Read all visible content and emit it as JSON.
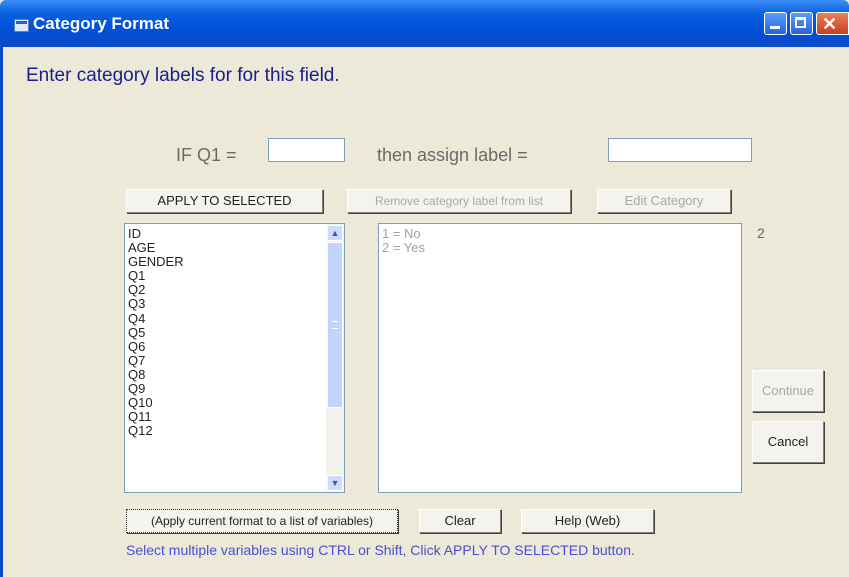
{
  "window": {
    "title": "Category Format"
  },
  "heading": "Enter category labels for for this field.",
  "condition": {
    "if_label": "IF Q1 =",
    "if_value": "",
    "then_label": "then assign label =",
    "label_value": ""
  },
  "buttons": {
    "apply_selected": "APPLY TO SELECTED",
    "remove": "Remove category label from list",
    "edit": "Edit Category",
    "continue": "Continue",
    "cancel": "Cancel",
    "apply_list": "Apply current format to a list of variables",
    "clear": "Clear",
    "help": "Help (Web)"
  },
  "variables": [
    "ID",
    "AGE",
    "GENDER",
    "Q1",
    "Q2",
    "Q3",
    "Q4",
    "Q5",
    "Q6",
    "Q7",
    "Q8",
    "Q9",
    "Q10",
    "Q11",
    "Q12"
  ],
  "labels": [
    "1 = No",
    "2 = Yes"
  ],
  "label_count": "2",
  "hint": "Select multiple variables using CTRL or Shift, Click APPLY TO SELECTED button."
}
